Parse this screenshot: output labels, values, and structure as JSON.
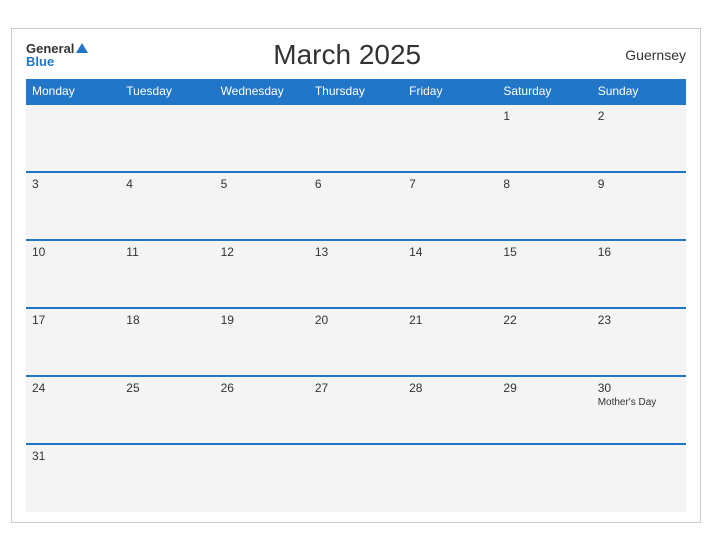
{
  "header": {
    "logo_general": "General",
    "logo_blue": "Blue",
    "title": "March 2025",
    "region": "Guernsey"
  },
  "weekdays": [
    "Monday",
    "Tuesday",
    "Wednesday",
    "Thursday",
    "Friday",
    "Saturday",
    "Sunday"
  ],
  "weeks": [
    [
      {
        "day": "",
        "event": ""
      },
      {
        "day": "",
        "event": ""
      },
      {
        "day": "",
        "event": ""
      },
      {
        "day": "",
        "event": ""
      },
      {
        "day": "",
        "event": ""
      },
      {
        "day": "1",
        "event": ""
      },
      {
        "day": "2",
        "event": ""
      }
    ],
    [
      {
        "day": "3",
        "event": ""
      },
      {
        "day": "4",
        "event": ""
      },
      {
        "day": "5",
        "event": ""
      },
      {
        "day": "6",
        "event": ""
      },
      {
        "day": "7",
        "event": ""
      },
      {
        "day": "8",
        "event": ""
      },
      {
        "day": "9",
        "event": ""
      }
    ],
    [
      {
        "day": "10",
        "event": ""
      },
      {
        "day": "11",
        "event": ""
      },
      {
        "day": "12",
        "event": ""
      },
      {
        "day": "13",
        "event": ""
      },
      {
        "day": "14",
        "event": ""
      },
      {
        "day": "15",
        "event": ""
      },
      {
        "day": "16",
        "event": ""
      }
    ],
    [
      {
        "day": "17",
        "event": ""
      },
      {
        "day": "18",
        "event": ""
      },
      {
        "day": "19",
        "event": ""
      },
      {
        "day": "20",
        "event": ""
      },
      {
        "day": "21",
        "event": ""
      },
      {
        "day": "22",
        "event": ""
      },
      {
        "day": "23",
        "event": ""
      }
    ],
    [
      {
        "day": "24",
        "event": ""
      },
      {
        "day": "25",
        "event": ""
      },
      {
        "day": "26",
        "event": ""
      },
      {
        "day": "27",
        "event": ""
      },
      {
        "day": "28",
        "event": ""
      },
      {
        "day": "29",
        "event": ""
      },
      {
        "day": "30",
        "event": "Mother's Day"
      }
    ],
    [
      {
        "day": "31",
        "event": ""
      },
      {
        "day": "",
        "event": ""
      },
      {
        "day": "",
        "event": ""
      },
      {
        "day": "",
        "event": ""
      },
      {
        "day": "",
        "event": ""
      },
      {
        "day": "",
        "event": ""
      },
      {
        "day": "",
        "event": ""
      }
    ]
  ]
}
